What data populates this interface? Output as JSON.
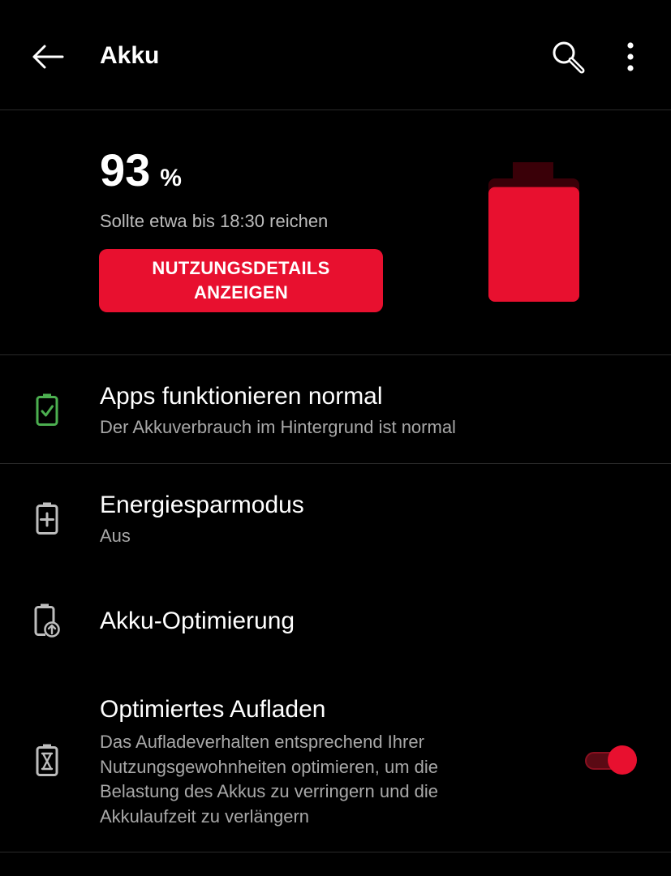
{
  "header": {
    "title": "Akku",
    "back_icon": "arrow-left-icon",
    "search_icon": "search-icon",
    "more_icon": "more-vertical-icon"
  },
  "summary": {
    "percent": "93",
    "percent_unit": "%",
    "level": 0.93,
    "estimate": "Sollte etwa bis 18:30 reichen",
    "details_button_line1": "NUTZUNGSDETAILS",
    "details_button_line2": "ANZEIGEN"
  },
  "items": [
    {
      "title": "Apps funktionieren normal",
      "subtitle": "Der Akkuverbrauch im Hintergrund ist normal",
      "icon": "battery-check-icon"
    },
    {
      "title": "Energiesparmodus",
      "subtitle": "Aus",
      "icon": "battery-plus-icon"
    },
    {
      "title": "Akku-Optimierung",
      "icon": "battery-optimize-icon"
    },
    {
      "title": "Optimiertes Aufladen",
      "subtitle_lines": [
        "Das Aufladeverhalten entsprechend Ihrer",
        "Nutzungsgewohnheiten optimieren, um die",
        "Belastung des Akkus zu verringern und die",
        "Akkulaufzeit zu verlängern"
      ],
      "icon": "battery-hourglass-icon",
      "toggle_on": true
    }
  ],
  "colors": {
    "accent": "#e8102f",
    "accent_dark": "#3a0008",
    "ok_green": "#4caf50",
    "icon_gray": "#bdbdbd",
    "background": "#000000"
  }
}
